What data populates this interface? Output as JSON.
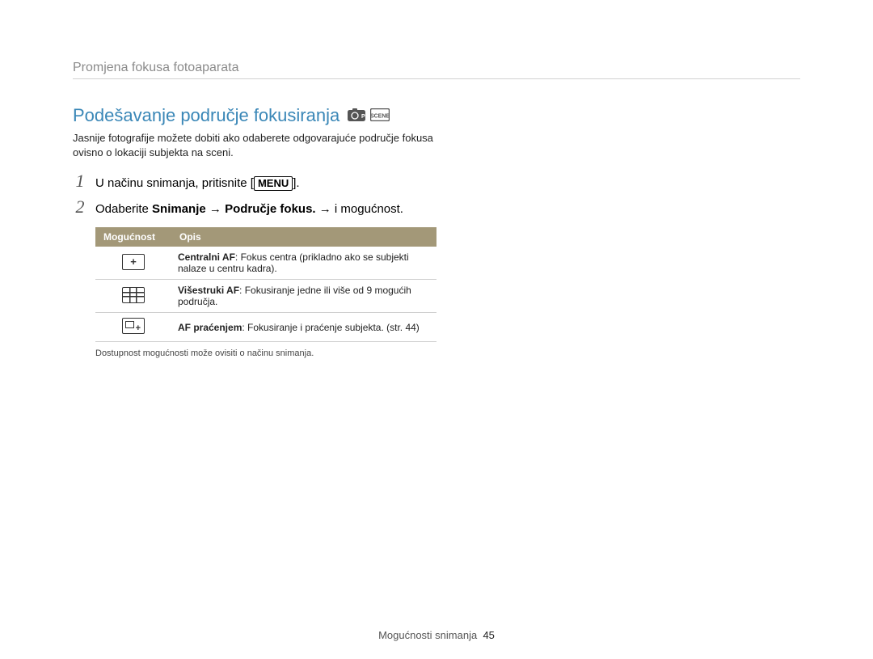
{
  "breadcrumb": "Promjena fokusa fotoaparata",
  "section_title": "Podešavanje područje fokusiranja",
  "mode_icons": [
    "camera-p-icon",
    "scene-icon"
  ],
  "intro": "Jasnije fotografije možete dobiti ako odaberete odgovarajuće područje fokusa ovisno o lokaciji subjekta na sceni.",
  "steps": [
    {
      "num": "1",
      "prefix": "U načinu snimanja, pritisnite [",
      "button": "MENU",
      "suffix": "]."
    },
    {
      "num": "2",
      "prefix": "Odaberite ",
      "bold": "Snimanje → Područje fokus.",
      "suffix": " → i mogućnost."
    }
  ],
  "table": {
    "headers": [
      "Mogućnost",
      "Opis"
    ],
    "rows": [
      {
        "icon": "af-center-icon",
        "bold": "Centralni AF",
        "text": ": Fokus centra (prikladno ako se subjekti nalaze u centru kadra)."
      },
      {
        "icon": "af-multi-icon",
        "bold": "Višestruki AF",
        "text": ": Fokusiranje jedne ili više od 9 mogućih područja."
      },
      {
        "icon": "af-tracking-icon",
        "bold": "AF praćenjem",
        "text": ": Fokusiranje i praćenje subjekta. (str. 44)"
      }
    ]
  },
  "footnote": "Dostupnost mogućnosti može ovisiti o načinu snimanja.",
  "footer": {
    "label": "Mogućnosti snimanja",
    "page": "45"
  }
}
